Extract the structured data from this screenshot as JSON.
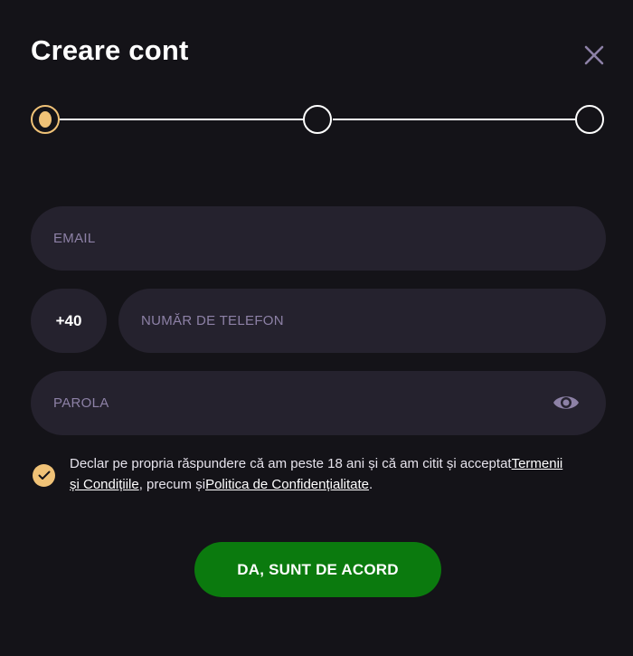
{
  "modal": {
    "title": "Creare cont",
    "close_icon": "close-icon"
  },
  "stepper": {
    "steps_total": 3,
    "current_step": 1,
    "accent_color": "#f0c277"
  },
  "form": {
    "email_placeholder": "EMAIL",
    "phone_prefix": "+40",
    "phone_placeholder": "NUMĂR DE TELEFON",
    "password_placeholder": "PAROLA",
    "password_toggle_icon": "eye-icon"
  },
  "consent": {
    "checked": true,
    "text_before": "Declar pe propria răspundere că am peste 18 ani și că am citit și acceptat",
    "terms_link": "Termenii și Condițiile",
    "text_middle": ", precum și",
    "privacy_link": "Politica de Confidențialitate",
    "text_after": "."
  },
  "submit": {
    "label": "DA, SUNT DE ACORD",
    "color": "#0b7a0e"
  },
  "colors": {
    "background": "#141318",
    "field_background": "#25222e",
    "placeholder": "#8d81a6",
    "accent": "#f0c277"
  }
}
